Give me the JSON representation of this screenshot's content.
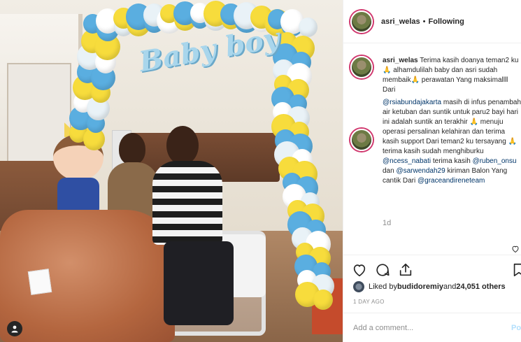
{
  "photo": {
    "sign_text": "Baby boy",
    "alt": "",
    "user_tag_icon": "person-icon"
  },
  "header": {
    "username": "asri_welas",
    "separator": "•",
    "follow_label": "Following"
  },
  "caption": {
    "username": "asri_welas",
    "segments": [
      {
        "type": "text",
        "value": " Terima kasih doanya teman2 ku "
      },
      {
        "type": "emoji",
        "value": "🙏"
      },
      {
        "type": "text",
        "value": " alhamdulilah baby dan asri sudah membaik"
      },
      {
        "type": "emoji",
        "value": "🙏"
      },
      {
        "type": "text",
        "value": " perawatan Yang maksimallll Dari"
      }
    ]
  },
  "comment2": {
    "segments": [
      {
        "type": "mention",
        "value": "@rsiabundajakarta"
      },
      {
        "type": "text",
        "value": " masih di infus penambah air ketuban dan suntik untuk paru2 bayi hari ini adalah suntik an terakhir "
      },
      {
        "type": "emoji",
        "value": "🙏"
      },
      {
        "type": "text",
        "value": " menuju operasi persalinan kelahiran dan terima kasih support Dari teman2 ku tersayang "
      },
      {
        "type": "emoji",
        "value": "🙏"
      },
      {
        "type": "text",
        "value": " terima kasih sudah menghiburku "
      },
      {
        "type": "mention",
        "value": "@ncess_nabati"
      },
      {
        "type": "text",
        "value": " terima kasih "
      },
      {
        "type": "mention",
        "value": "@ruben_onsu"
      },
      {
        "type": "text",
        "value": " dan "
      },
      {
        "type": "mention",
        "value": "@sarwendah29"
      },
      {
        "type": "text",
        "value": " kiriman Balon Yang cantik Dari "
      },
      {
        "type": "mention",
        "value": "@graceandireneteam"
      }
    ]
  },
  "comment_time": "1d",
  "actions": {
    "like_icon": "heart-icon",
    "comment_icon": "comment-icon",
    "share_icon": "share-icon",
    "save_icon": "bookmark-icon"
  },
  "likes": {
    "prefix": "Liked by ",
    "user": "budidoremiy",
    "middle": " and ",
    "count": "24,051 others"
  },
  "date": "1 DAY AGO",
  "add_comment": {
    "placeholder": "Add a comment...",
    "post_label": "Post"
  },
  "colors": {
    "story_ring": "#d0376d",
    "mention": "#003569",
    "muted": "#8e8e8e",
    "post_disabled": "#b2dffc"
  }
}
